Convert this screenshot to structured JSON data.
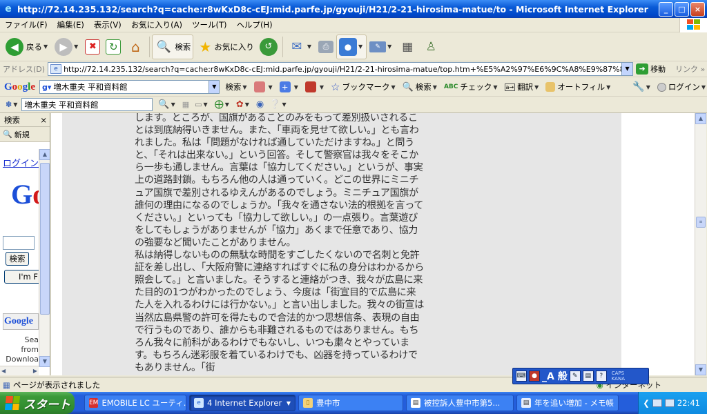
{
  "window": {
    "title": "http://72.14.235.132/search?q=cache:r8wKxD8c-cEJ:mid.parfe.jp/gyouji/H21/2-21-hirosima-matue/to - Microsoft Internet Explorer",
    "minimize": "_",
    "maximize": "□",
    "close": "×"
  },
  "menu": [
    "ファイル(F)",
    "編集(E)",
    "表示(V)",
    "お気に入り(A)",
    "ツール(T)",
    "ヘルプ(H)"
  ],
  "toolbar": {
    "back": "戻る",
    "search": "検索",
    "favorites": "お気に入り"
  },
  "address": {
    "label": "アドレス(D)",
    "url": "http://72.14.235.132/search?q=cache:r8wKxD8c-cEJ:mid.parfe.jp/gyouji/H21/2-21-hirosima-matue/top.htm+%E5%A2%97%E6%9C%A8%E9%87%8D%E5%A4%AB%E3",
    "go": "移動",
    "links": "リンク"
  },
  "google_bar": {
    "logo": "Google",
    "query": "増木重夫 平和資料館",
    "search_btn": "検索",
    "bookmarks": "ブックマーク",
    "search2": "検索",
    "check": "チェック",
    "translate": "翻訳",
    "autofill": "オートフィル",
    "login": "ログイン"
  },
  "jp_bar": {
    "query": "増木重夫 平和資料館"
  },
  "side_pane": {
    "title": "検索",
    "close": "×",
    "new_btn": "新規",
    "login_link": "ログイン",
    "logo": "Go",
    "search_btn": "検索",
    "lucky_btn": "I'm F",
    "google_small": "Google",
    "lines": [
      "Sea",
      "from",
      "Downloa"
    ]
  },
  "article": {
    "paragraphs": [
      "します。ところが、国旗があることのみをもって差別扱いされることは到底納得いきません。また、「車両を見せて欲しい。」とも言われました。私は「問題がなければ通していただけますね。」と問うと、「それは出来ない。」という回答。そして警察官は我々をそこから一歩も通しません。言葉は「協力してください。」というが、事実上の道路封鎖。もちろん他の人は通っていく。どこの世界にミニチュア国旗で差別されるゆえんがあるのでしょう。ミニチュア国旗が誰何の理由になるのでしょうか。「我々を通さない法的根拠を言ってください。」といっても「協力して欲しい。」の一点張り。言葉遊びをしてもしょうがありませんが「協力」あくまで任意であり、協力の強要など聞いたことがありません。",
      "私は納得しないものの無駄な時間をすごしたくないので名刺と免許証を差し出し、「大阪府警に連絡すればすぐに私の身分はわかるから照会して。」と言いました。そうすると連絡がつき、我々が広島に来た目的の1つがわかったのでしょう、今度は「街宣目的で広島に来た人を入れるわけには行かない。」と言い出しました。我々の街宣は当然広島県警の許可を得たもので合法的かつ思想信条、表現の自由で行うものであり、誰からも非難されるものではありません。もちろん我々に前科があるわけでもないし、いつも粛々とやっています。もちろん迷彩服を着ているわけでも、凶器を持っているわけでもありません。「街"
    ]
  },
  "status": {
    "text": "ページが表示されました",
    "zone": "インターネット"
  },
  "ime": {
    "mode": "_A 般",
    "caps": "CAPS",
    "kana": "KANA"
  },
  "taskbar": {
    "start": "スタート",
    "tasks": [
      {
        "label": "EMOBILE LC ユーティ...",
        "icon": "em"
      },
      {
        "label": "4 Internet Explorer",
        "icon": "ie"
      },
      {
        "label": "豊中市",
        "icon": "folder"
      },
      {
        "label": "被控訴人豊中市第5...",
        "icon": "doc"
      },
      {
        "label": "年を追い増加 - メモ帳",
        "icon": "notepad"
      }
    ],
    "clock": "22:41"
  },
  "colors": {
    "title_blue": "#0a5bd6",
    "taskbar_blue": "#245edb",
    "start_green": "#3c9a3a",
    "page_gray": "#e6e6e6"
  }
}
